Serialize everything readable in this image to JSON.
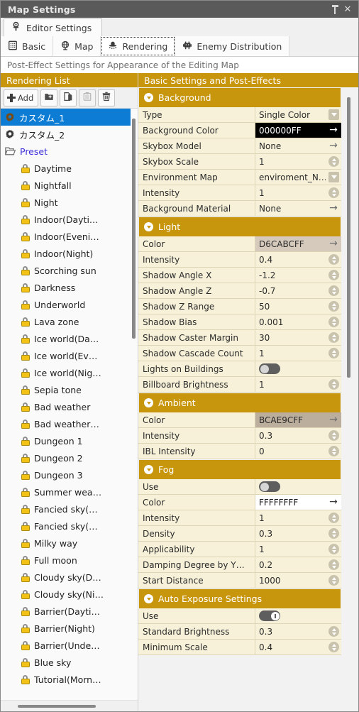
{
  "window": {
    "title": "Map Settings",
    "pin_icon": "pin-icon",
    "close_icon": "close-icon"
  },
  "top_tab": {
    "label": "Editor Settings",
    "icon": "editor-settings-icon"
  },
  "sub_tabs": [
    {
      "label": "Basic",
      "icon": "grid-icon",
      "active": false
    },
    {
      "label": "Map",
      "icon": "globe-icon",
      "active": false
    },
    {
      "label": "Rendering",
      "icon": "rendering-icon",
      "active": true
    },
    {
      "label": "Enemy Distribution",
      "icon": "enemy-icon",
      "active": false
    }
  ],
  "description": "Post-Effect Settings for Appearance of the Editing Map",
  "left_panel": {
    "header": "Rendering List",
    "toolbar": [
      {
        "name": "add-button",
        "label": "Add",
        "icon": "plus-icon",
        "disabled": false
      },
      {
        "name": "new-folder-button",
        "label": "",
        "icon": "new-folder-icon",
        "disabled": false
      },
      {
        "name": "duplicate-button",
        "label": "",
        "icon": "copy-icon",
        "disabled": false
      },
      {
        "name": "paste-button",
        "label": "",
        "icon": "paste-icon",
        "disabled": true
      },
      {
        "name": "delete-button",
        "label": "",
        "icon": "trash-icon",
        "disabled": false
      }
    ],
    "items": [
      {
        "label": "カスタム_1",
        "icon": "gear-icon",
        "kind": "custom",
        "selected": true,
        "indent": false
      },
      {
        "label": "カスタム_2",
        "icon": "gear-icon",
        "kind": "custom",
        "selected": false,
        "indent": false
      },
      {
        "label": "Preset",
        "icon": "folder-icon",
        "kind": "folder",
        "selected": false,
        "indent": false
      },
      {
        "label": "Daytime",
        "icon": "lock-icon",
        "kind": "locked",
        "selected": false,
        "indent": true
      },
      {
        "label": "Nightfall",
        "icon": "lock-icon",
        "kind": "locked",
        "selected": false,
        "indent": true
      },
      {
        "label": "Night",
        "icon": "lock-icon",
        "kind": "locked",
        "selected": false,
        "indent": true
      },
      {
        "label": "Indoor(Dayti…",
        "icon": "lock-icon",
        "kind": "locked",
        "selected": false,
        "indent": true
      },
      {
        "label": "Indoor(Eveni…",
        "icon": "lock-icon",
        "kind": "locked",
        "selected": false,
        "indent": true
      },
      {
        "label": "Indoor(Night)",
        "icon": "lock-icon",
        "kind": "locked",
        "selected": false,
        "indent": true
      },
      {
        "label": "Scorching sun",
        "icon": "lock-icon",
        "kind": "locked",
        "selected": false,
        "indent": true
      },
      {
        "label": "Darkness",
        "icon": "lock-icon",
        "kind": "locked",
        "selected": false,
        "indent": true
      },
      {
        "label": "Underworld",
        "icon": "lock-icon",
        "kind": "locked",
        "selected": false,
        "indent": true
      },
      {
        "label": "Lava zone",
        "icon": "lock-icon",
        "kind": "locked",
        "selected": false,
        "indent": true
      },
      {
        "label": "Ice world(Da…",
        "icon": "lock-icon",
        "kind": "locked",
        "selected": false,
        "indent": true
      },
      {
        "label": "Ice world(Ev…",
        "icon": "lock-icon",
        "kind": "locked",
        "selected": false,
        "indent": true
      },
      {
        "label": "Ice world(Nig…",
        "icon": "lock-icon",
        "kind": "locked",
        "selected": false,
        "indent": true
      },
      {
        "label": "Sepia tone",
        "icon": "lock-icon",
        "kind": "locked",
        "selected": false,
        "indent": true
      },
      {
        "label": "Bad weather",
        "icon": "lock-icon",
        "kind": "locked",
        "selected": false,
        "indent": true
      },
      {
        "label": "Bad weather…",
        "icon": "lock-icon",
        "kind": "locked",
        "selected": false,
        "indent": true
      },
      {
        "label": "Dungeon 1",
        "icon": "lock-icon",
        "kind": "locked",
        "selected": false,
        "indent": true
      },
      {
        "label": "Dungeon 2",
        "icon": "lock-icon",
        "kind": "locked",
        "selected": false,
        "indent": true
      },
      {
        "label": "Dungeon 3",
        "icon": "lock-icon",
        "kind": "locked",
        "selected": false,
        "indent": true
      },
      {
        "label": "Summer wea…",
        "icon": "lock-icon",
        "kind": "locked",
        "selected": false,
        "indent": true
      },
      {
        "label": "Fancied sky(…",
        "icon": "lock-icon",
        "kind": "locked",
        "selected": false,
        "indent": true
      },
      {
        "label": "Fancied sky(…",
        "icon": "lock-icon",
        "kind": "locked",
        "selected": false,
        "indent": true
      },
      {
        "label": "Milky way",
        "icon": "lock-icon",
        "kind": "locked",
        "selected": false,
        "indent": true
      },
      {
        "label": "Full moon",
        "icon": "lock-icon",
        "kind": "locked",
        "selected": false,
        "indent": true
      },
      {
        "label": "Cloudy sky(D…",
        "icon": "lock-icon",
        "kind": "locked",
        "selected": false,
        "indent": true
      },
      {
        "label": "Cloudy sky(Ni…",
        "icon": "lock-icon",
        "kind": "locked",
        "selected": false,
        "indent": true
      },
      {
        "label": "Barrier(Dayti…",
        "icon": "lock-icon",
        "kind": "locked",
        "selected": false,
        "indent": true
      },
      {
        "label": "Barrier(Night)",
        "icon": "lock-icon",
        "kind": "locked",
        "selected": false,
        "indent": true
      },
      {
        "label": "Barrier(Unde…",
        "icon": "lock-icon",
        "kind": "locked",
        "selected": false,
        "indent": true
      },
      {
        "label": "Blue sky",
        "icon": "lock-icon",
        "kind": "locked",
        "selected": false,
        "indent": true
      },
      {
        "label": "Tutorial(Morn…",
        "icon": "lock-icon",
        "kind": "locked",
        "selected": false,
        "indent": true
      }
    ]
  },
  "right_panel": {
    "header": "Basic Settings and Post-Effects",
    "sections": [
      {
        "title": "Background",
        "expanded": true,
        "rows": [
          {
            "label": "Type",
            "value": "Single Color",
            "control": "dropdown"
          },
          {
            "label": "Background Color",
            "value": "000000FF",
            "control": "arrow",
            "swatch": "dark"
          },
          {
            "label": "Skybox Model",
            "value": "None",
            "control": "arrow"
          },
          {
            "label": "Skybox Scale",
            "value": "1",
            "control": "spinner"
          },
          {
            "label": "Environment Map",
            "value": "enviroment_N…",
            "control": "dropdown"
          },
          {
            "label": "Intensity",
            "value": "1",
            "control": "spinner"
          },
          {
            "label": "Background Material",
            "value": "None",
            "control": "arrow"
          }
        ]
      },
      {
        "title": "Light",
        "expanded": true,
        "rows": [
          {
            "label": "Color",
            "value": "D6CABCFF",
            "control": "arrow",
            "swatch": "d6cabc"
          },
          {
            "label": "Intensity",
            "value": "0.4",
            "control": "spinner"
          },
          {
            "label": "Shadow Angle X",
            "value": "-1.2",
            "control": "spinner"
          },
          {
            "label": "Shadow Angle Z",
            "value": "-0.7",
            "control": "spinner"
          },
          {
            "label": "Shadow Z Range",
            "value": "50",
            "control": "spinner"
          },
          {
            "label": "Shadow Bias",
            "value": "0.001",
            "control": "spinner"
          },
          {
            "label": "Shadow Caster Margin",
            "value": "30",
            "control": "spinner"
          },
          {
            "label": "Shadow Cascade Count",
            "value": "1",
            "control": "spinner"
          },
          {
            "label": "Lights on Buildings",
            "value": "",
            "control": "toggle",
            "toggle_on": false
          },
          {
            "label": "Billboard Brightness",
            "value": "1",
            "control": "spinner"
          }
        ]
      },
      {
        "title": "Ambient",
        "expanded": true,
        "rows": [
          {
            "label": "Color",
            "value": "BCAE9CFF",
            "control": "arrow",
            "swatch": "bcae9c"
          },
          {
            "label": "Intensity",
            "value": "0.3",
            "control": "spinner"
          },
          {
            "label": "IBL Intensity",
            "value": "0",
            "control": "spinner"
          }
        ]
      },
      {
        "title": "Fog",
        "expanded": true,
        "rows": [
          {
            "label": "Use",
            "value": "",
            "control": "toggle",
            "toggle_on": false
          },
          {
            "label": "Color",
            "value": "FFFFFFFF",
            "control": "arrow",
            "swatch": "white"
          },
          {
            "label": "Intensity",
            "value": "1",
            "control": "spinner"
          },
          {
            "label": "Density",
            "value": "0.3",
            "control": "spinner"
          },
          {
            "label": "Applicability",
            "value": "1",
            "control": "spinner"
          },
          {
            "label": "Damping Degree by Y…",
            "value": "0.2",
            "control": "spinner"
          },
          {
            "label": "Start Distance",
            "value": "1000",
            "control": "spinner"
          }
        ]
      },
      {
        "title": "Auto Exposure Settings",
        "expanded": true,
        "rows": [
          {
            "label": "Use",
            "value": "",
            "control": "toggle",
            "toggle_on": true
          },
          {
            "label": "Standard Brightness",
            "value": "0.3",
            "control": "spinner"
          },
          {
            "label": "Minimum Scale",
            "value": "0.4",
            "control": "spinner"
          }
        ]
      }
    ]
  },
  "colors": {
    "header_gold": "#C8960C",
    "row_cream": "#F6F1D8",
    "selection_blue": "#0C7CD5",
    "titlebar_gray": "#5A5A5A",
    "folder_link": "#3C2FD8"
  }
}
